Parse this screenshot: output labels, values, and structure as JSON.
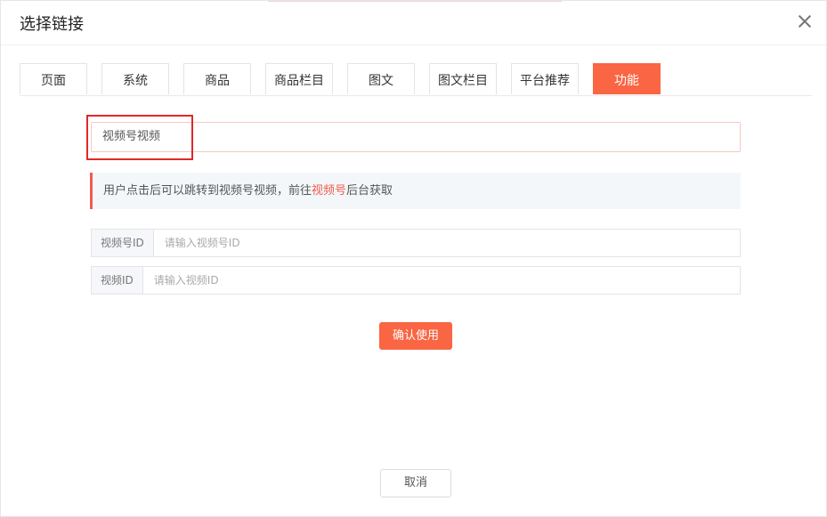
{
  "dialog": {
    "title": "选择链接"
  },
  "tabs": [
    {
      "label": "页面"
    },
    {
      "label": "系统"
    },
    {
      "label": "商品"
    },
    {
      "label": "商品栏目"
    },
    {
      "label": "图文"
    },
    {
      "label": "图文栏目"
    },
    {
      "label": "平台推荐"
    },
    {
      "label": "功能"
    }
  ],
  "active_tab": "功能",
  "selected_link": {
    "value": "视频号视频"
  },
  "tip": {
    "prefix": "用户点击后可以跳转到视频号视频，前往",
    "link_text": "视频号",
    "suffix": "后台获取"
  },
  "form": {
    "channel_id": {
      "label": "视频号ID",
      "placeholder": "请输入视频号ID"
    },
    "video_id": {
      "label": "视频ID",
      "placeholder": "请输入视频ID"
    }
  },
  "buttons": {
    "confirm": "确认使用",
    "cancel": "取消"
  },
  "colors": {
    "accent": "#fa6543",
    "highlight_red": "#e12828"
  }
}
